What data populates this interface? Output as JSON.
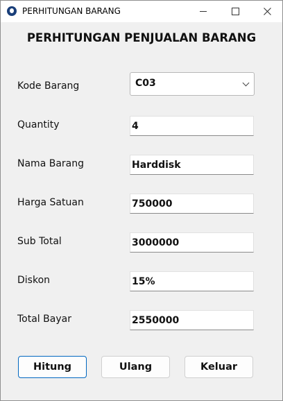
{
  "window": {
    "title": "PERHITUNGAN BARANG"
  },
  "icons": {
    "app": "app-logo-icon",
    "minimize": "minimize-icon",
    "maximize": "maximize-icon",
    "close": "close-icon",
    "dropdown": "chevron-down-icon"
  },
  "form": {
    "heading": "PERHITUNGAN PENJUALAN BARANG",
    "kode_barang": {
      "label": "Kode Barang",
      "value": "C03"
    },
    "quantity": {
      "label": "Quantity",
      "value": "4"
    },
    "nama_barang": {
      "label": "Nama Barang",
      "value": "Harddisk"
    },
    "harga_satuan": {
      "label": "Harga Satuan",
      "value": "750000"
    },
    "sub_total": {
      "label": "Sub Total",
      "value": "3000000"
    },
    "diskon": {
      "label": "Diskon",
      "value": "15%"
    },
    "total_bayar": {
      "label": "Total Bayar",
      "value": "2550000"
    }
  },
  "buttons": {
    "hitung": "Hitung",
    "ulang": "Ulang",
    "keluar": "Keluar"
  },
  "colors": {
    "accent": "#0067c0",
    "window_bg": "#f0f0f0"
  }
}
